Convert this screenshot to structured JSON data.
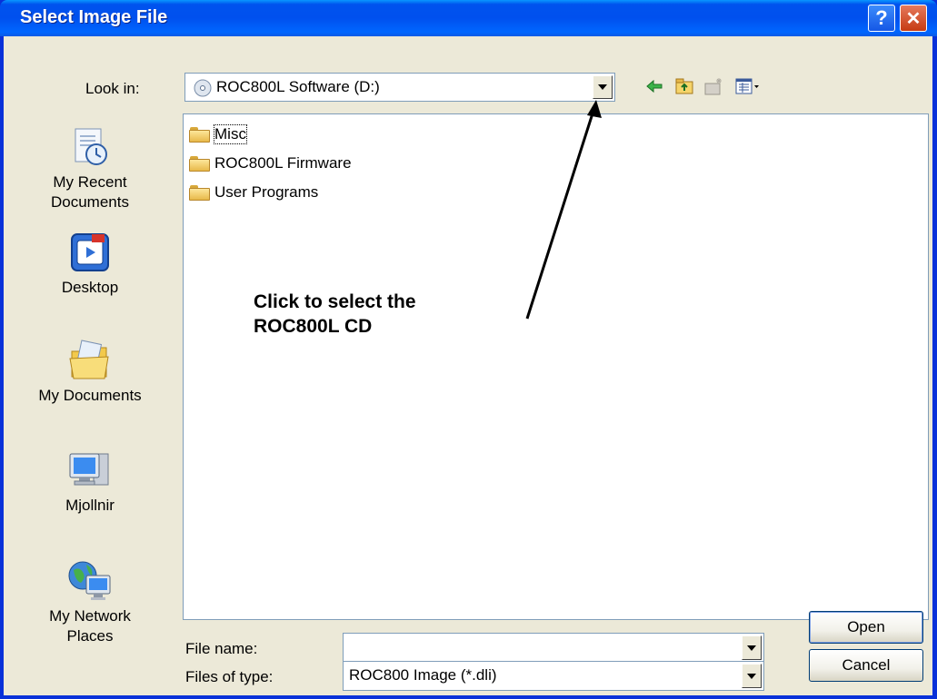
{
  "window": {
    "title": "Select Image File",
    "help_glyph": "?",
    "close_glyph": "✕"
  },
  "toolbar": {
    "look_in_label": "Look in:",
    "look_in_value": "ROC800L Software (D:)",
    "icons": [
      "back-icon",
      "up-folder-icon",
      "new-folder-icon",
      "views-menu-icon"
    ]
  },
  "places": [
    {
      "label": "My Recent Documents",
      "icon": "recent-documents-icon"
    },
    {
      "label": "Desktop",
      "icon": "desktop-icon"
    },
    {
      "label": "My Documents",
      "icon": "my-documents-icon"
    },
    {
      "label": "Mjollnir",
      "icon": "computer-icon"
    },
    {
      "label": "My Network Places",
      "icon": "network-places-icon"
    }
  ],
  "files": [
    {
      "name": "Misc"
    },
    {
      "name": "ROC800L Firmware"
    },
    {
      "name": "User Programs"
    }
  ],
  "form": {
    "file_name_label": "File name:",
    "file_name_value": "",
    "file_type_label": "Files of type:",
    "file_type_value": "ROC800 Image (*.dli)"
  },
  "buttons": {
    "open": "Open",
    "cancel": "Cancel"
  },
  "annotation": {
    "text": "Click to select the\nROC800L CD"
  },
  "colors": {
    "titlebar": "#0054e3",
    "client": "#ece9d8",
    "border": "#7f9db9"
  }
}
